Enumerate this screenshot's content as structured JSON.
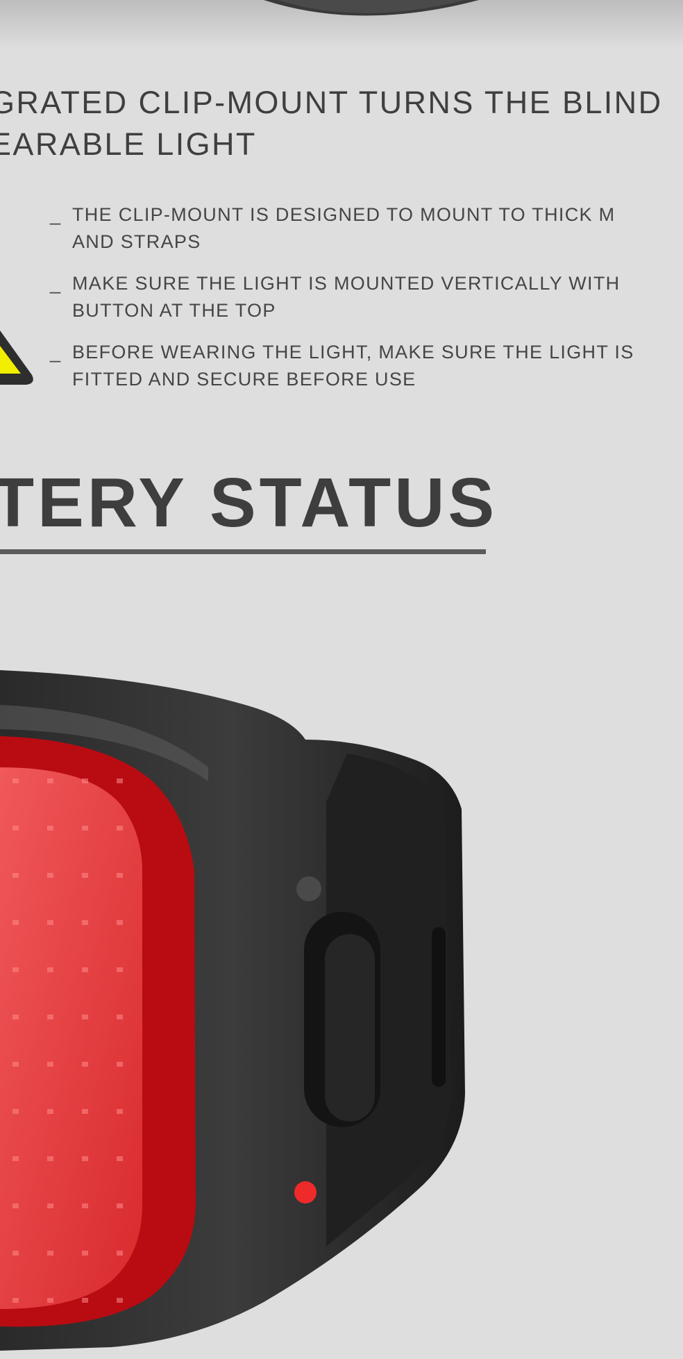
{
  "headline": {
    "line1": "GRATED CLIP-MOUNT TURNS THE BLIND",
    "line2": "EARABLE LIGHT"
  },
  "bullets": [
    {
      "dash": "_",
      "line1": "THE CLIP-MOUNT IS DESIGNED TO MOUNT TO THICK M",
      "line2": "AND STRAPS"
    },
    {
      "dash": "_",
      "line1": "MAKE SURE THE LIGHT IS MOUNTED VERTICALLY WITH",
      "line2": "BUTTON AT THE TOP"
    },
    {
      "dash": "_",
      "line1": "BEFORE WEARING THE LIGHT, MAKE SURE THE LIGHT IS",
      "line2": "FITTED AND SECURE BEFORE USE"
    }
  ],
  "section": {
    "title": "TERY STATUS"
  },
  "icons": {
    "warning": "warning-triangle-icon"
  },
  "colors": {
    "background": "#dedede",
    "text": "#3d3d3d",
    "warning_yellow": "#f2ee00",
    "light_red": "#e8141b"
  }
}
